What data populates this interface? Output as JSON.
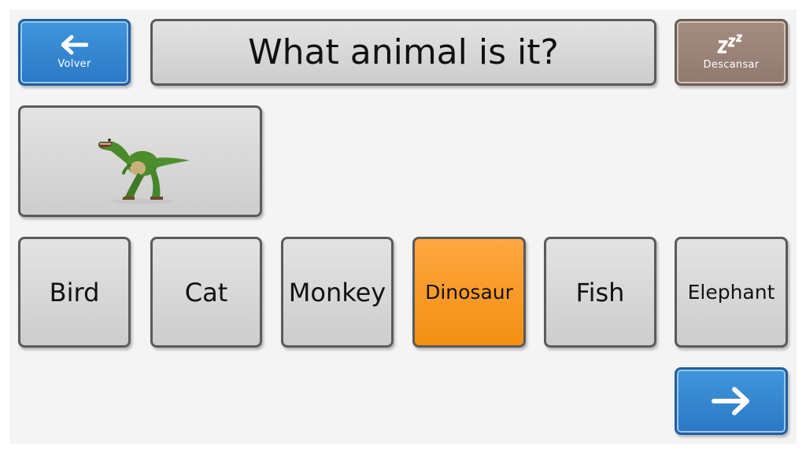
{
  "header": {
    "back_label": "Volver",
    "question": "What animal is it?",
    "rest_label": "Descansar"
  },
  "options": [
    {
      "label": "Bird"
    },
    {
      "label": "Cat"
    },
    {
      "label": "Monkey"
    },
    {
      "label": "Dinosaur",
      "selected": true
    },
    {
      "label": "Fish"
    },
    {
      "label": "Elephant"
    }
  ],
  "icons": {
    "back": "arrow-left-icon",
    "rest": "zzz-sleep-icon",
    "next": "arrow-right-icon",
    "image": "dinosaur-picture"
  },
  "colors": {
    "nav_blue": "#2a78c6",
    "rest_brown": "#9a8378",
    "selected_orange": "#f7981f",
    "button_gray": "#d8d8d8"
  }
}
